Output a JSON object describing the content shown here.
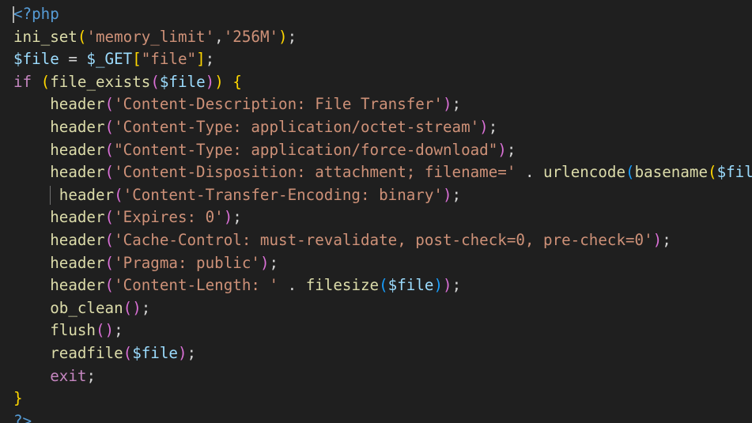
{
  "editor": {
    "language": "php",
    "colors": {
      "background": "#1f1f1f",
      "default": "#d4d4d4",
      "function": "#dcdcaa",
      "string": "#ce9178",
      "variable": "#9cdcfe",
      "keyword": "#c586c0",
      "tag": "#569cd6",
      "bracket_1": "#ffd700",
      "bracket_2": "#da70d6",
      "bracket_3": "#179fff",
      "indent_guide": "#707070",
      "cursor": "#aeafad"
    },
    "lines": [
      {
        "name": "line-php-open",
        "cursor": true,
        "tokens": [
          {
            "t": "<?php",
            "c": "tag"
          }
        ]
      },
      {
        "name": "line-ini-set",
        "tokens": [
          {
            "t": "ini_set",
            "c": "fn"
          },
          {
            "t": "(",
            "c": "b1"
          },
          {
            "t": "'memory_limit'",
            "c": "str"
          },
          {
            "t": ",",
            "c": "tok"
          },
          {
            "t": "'256M'",
            "c": "str"
          },
          {
            "t": ")",
            "c": "b1"
          },
          {
            "t": ";",
            "c": "tok"
          }
        ]
      },
      {
        "name": "line-file-assign",
        "tokens": [
          {
            "t": "$file",
            "c": "var"
          },
          {
            "t": " = ",
            "c": "tok"
          },
          {
            "t": "$_GET",
            "c": "var"
          },
          {
            "t": "[",
            "c": "b1"
          },
          {
            "t": "\"file\"",
            "c": "str"
          },
          {
            "t": "]",
            "c": "b1"
          },
          {
            "t": ";",
            "c": "tok"
          }
        ]
      },
      {
        "name": "line-if-file-exists",
        "tokens": [
          {
            "t": "if",
            "c": "kw"
          },
          {
            "t": " ",
            "c": "tok"
          },
          {
            "t": "(",
            "c": "b1"
          },
          {
            "t": "file_exists",
            "c": "fn"
          },
          {
            "t": "(",
            "c": "b2"
          },
          {
            "t": "$file",
            "c": "var"
          },
          {
            "t": ")",
            "c": "b2"
          },
          {
            "t": ")",
            "c": "b1"
          },
          {
            "t": " ",
            "c": "tok"
          },
          {
            "t": "{",
            "c": "b1"
          }
        ]
      },
      {
        "name": "line-header-description",
        "tokens": [
          {
            "t": "    ",
            "c": "tok"
          },
          {
            "t": "header",
            "c": "fn"
          },
          {
            "t": "(",
            "c": "b2"
          },
          {
            "t": "'Content-Description: File Transfer'",
            "c": "str"
          },
          {
            "t": ")",
            "c": "b2"
          },
          {
            "t": ";",
            "c": "tok"
          }
        ]
      },
      {
        "name": "line-header-octet-stream",
        "tokens": [
          {
            "t": "    ",
            "c": "tok"
          },
          {
            "t": "header",
            "c": "fn"
          },
          {
            "t": "(",
            "c": "b2"
          },
          {
            "t": "'Content-Type: application/octet-stream'",
            "c": "str"
          },
          {
            "t": ")",
            "c": "b2"
          },
          {
            "t": ";",
            "c": "tok"
          }
        ]
      },
      {
        "name": "line-header-force-download",
        "tokens": [
          {
            "t": "    ",
            "c": "tok"
          },
          {
            "t": "header",
            "c": "fn"
          },
          {
            "t": "(",
            "c": "b2"
          },
          {
            "t": "\"Content-Type: application/force-download\"",
            "c": "str"
          },
          {
            "t": ")",
            "c": "b2"
          },
          {
            "t": ";",
            "c": "tok"
          }
        ]
      },
      {
        "name": "line-header-disposition",
        "tokens": [
          {
            "t": "    ",
            "c": "tok"
          },
          {
            "t": "header",
            "c": "fn"
          },
          {
            "t": "(",
            "c": "b2"
          },
          {
            "t": "'Content-Disposition: attachment; filename='",
            "c": "str"
          },
          {
            "t": " . ",
            "c": "tok"
          },
          {
            "t": "urlencode",
            "c": "fn"
          },
          {
            "t": "(",
            "c": "b3"
          },
          {
            "t": "basename",
            "c": "fn"
          },
          {
            "t": "(",
            "c": "b1"
          },
          {
            "t": "$fil",
            "c": "var"
          }
        ]
      },
      {
        "name": "line-header-transfer-encoding",
        "guide": true,
        "tokens": [
          {
            "t": "     ",
            "c": "tok"
          },
          {
            "t": "header",
            "c": "fn"
          },
          {
            "t": "(",
            "c": "b2"
          },
          {
            "t": "'Content-Transfer-Encoding: binary'",
            "c": "str"
          },
          {
            "t": ")",
            "c": "b2"
          },
          {
            "t": ";",
            "c": "tok"
          }
        ]
      },
      {
        "name": "line-header-expires",
        "tokens": [
          {
            "t": "    ",
            "c": "tok"
          },
          {
            "t": "header",
            "c": "fn"
          },
          {
            "t": "(",
            "c": "b2"
          },
          {
            "t": "'Expires: 0'",
            "c": "str"
          },
          {
            "t": ")",
            "c": "b2"
          },
          {
            "t": ";",
            "c": "tok"
          }
        ]
      },
      {
        "name": "line-header-cache-control",
        "tokens": [
          {
            "t": "    ",
            "c": "tok"
          },
          {
            "t": "header",
            "c": "fn"
          },
          {
            "t": "(",
            "c": "b2"
          },
          {
            "t": "'Cache-Control: must-revalidate, post-check=0, pre-check=0'",
            "c": "str"
          },
          {
            "t": ")",
            "c": "b2"
          },
          {
            "t": ";",
            "c": "tok"
          }
        ]
      },
      {
        "name": "line-header-pragma",
        "tokens": [
          {
            "t": "    ",
            "c": "tok"
          },
          {
            "t": "header",
            "c": "fn"
          },
          {
            "t": "(",
            "c": "b2"
          },
          {
            "t": "'Pragma: public'",
            "c": "str"
          },
          {
            "t": ")",
            "c": "b2"
          },
          {
            "t": ";",
            "c": "tok"
          }
        ]
      },
      {
        "name": "line-header-content-length",
        "tokens": [
          {
            "t": "    ",
            "c": "tok"
          },
          {
            "t": "header",
            "c": "fn"
          },
          {
            "t": "(",
            "c": "b2"
          },
          {
            "t": "'Content-Length: '",
            "c": "str"
          },
          {
            "t": " . ",
            "c": "tok"
          },
          {
            "t": "filesize",
            "c": "fn"
          },
          {
            "t": "(",
            "c": "b3"
          },
          {
            "t": "$file",
            "c": "var"
          },
          {
            "t": ")",
            "c": "b3"
          },
          {
            "t": ")",
            "c": "b2"
          },
          {
            "t": ";",
            "c": "tok"
          }
        ]
      },
      {
        "name": "line-ob-clean",
        "tokens": [
          {
            "t": "    ",
            "c": "tok"
          },
          {
            "t": "ob_clean",
            "c": "fn"
          },
          {
            "t": "(",
            "c": "b2"
          },
          {
            "t": ")",
            "c": "b2"
          },
          {
            "t": ";",
            "c": "tok"
          }
        ]
      },
      {
        "name": "line-flush",
        "tokens": [
          {
            "t": "    ",
            "c": "tok"
          },
          {
            "t": "flush",
            "c": "fn"
          },
          {
            "t": "(",
            "c": "b2"
          },
          {
            "t": ")",
            "c": "b2"
          },
          {
            "t": ";",
            "c": "tok"
          }
        ]
      },
      {
        "name": "line-readfile",
        "tokens": [
          {
            "t": "    ",
            "c": "tok"
          },
          {
            "t": "readfile",
            "c": "fn"
          },
          {
            "t": "(",
            "c": "b2"
          },
          {
            "t": "$file",
            "c": "var"
          },
          {
            "t": ")",
            "c": "b2"
          },
          {
            "t": ";",
            "c": "tok"
          }
        ]
      },
      {
        "name": "line-exit",
        "tokens": [
          {
            "t": "    ",
            "c": "tok"
          },
          {
            "t": "exit",
            "c": "kw"
          },
          {
            "t": ";",
            "c": "tok"
          }
        ]
      },
      {
        "name": "line-close-brace",
        "tokens": [
          {
            "t": "}",
            "c": "b1"
          }
        ]
      },
      {
        "name": "line-php-close",
        "tokens": [
          {
            "t": "?>",
            "c": "tag"
          }
        ]
      }
    ]
  }
}
